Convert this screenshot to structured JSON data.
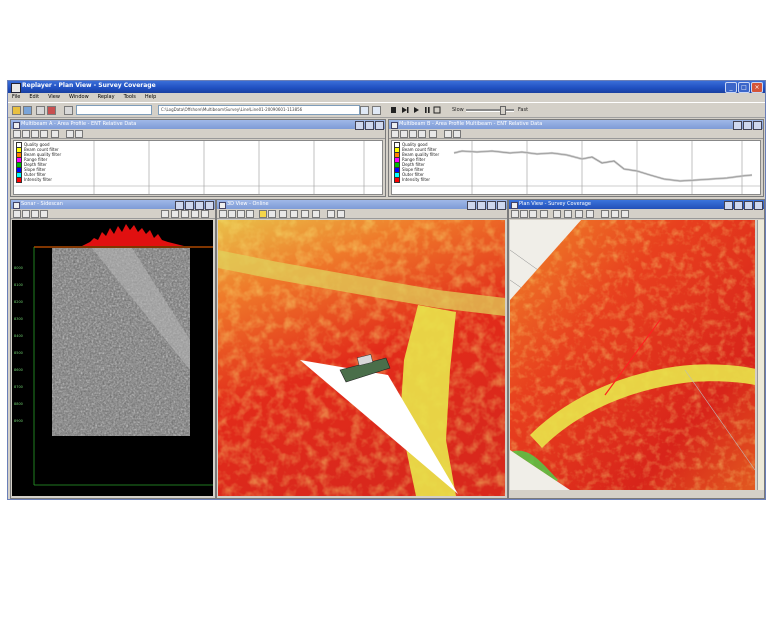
{
  "window": {
    "title": "Replayer - Plan View - Survey Coverage",
    "buttons": [
      "_",
      "□",
      "×"
    ]
  },
  "menu": [
    "File",
    "Edit",
    "View",
    "Window",
    "Replay",
    "Tools",
    "Help"
  ],
  "toolbar": {
    "path_value": "C:\\LogData\\Offshore\\Multibeam\\Survey\\Line\\Line01-20090601-113856",
    "speed_label": "Slow",
    "fast_label": "Fast"
  },
  "panes": {
    "profile_left": {
      "title": "Multibeam A - Area Profile - ENT Relative Data",
      "legend": [
        "Quality good",
        "Beam count filter",
        "Beam quality filter",
        "Range filter",
        "Depth filter",
        "Slope filter",
        "Outer filter",
        "Intensity filter"
      ],
      "legend_colors": [
        "#ffffff",
        "#ffff00",
        "#ff8000",
        "#ff00ff",
        "#00c000",
        "#0000ff",
        "#00ffff",
        "#ff0000"
      ]
    },
    "profile_right": {
      "title": "Multibeam B - Area Profile Multibeam - ENT Relative Data",
      "legend": [
        "Quality good",
        "Beam count filter",
        "Beam quality filter",
        "Range filter",
        "Depth filter",
        "Slope filter",
        "Outer filter",
        "Intensity filter"
      ],
      "legend_colors": [
        "#ffffff",
        "#ffff00",
        "#ff8000",
        "#ff00ff",
        "#00c000",
        "#0000ff",
        "#00ffff",
        "#ff0000"
      ]
    },
    "sonar": {
      "title": "Sonar - Sidescan",
      "axis_labels": [
        "8000",
        "8100",
        "8200",
        "8300",
        "8400",
        "8500",
        "8600",
        "8700",
        "8800",
        "8900"
      ]
    },
    "view3d": {
      "title": "3D View - Online"
    },
    "planview": {
      "title": "Plan View - Survey Coverage"
    }
  },
  "colors": {
    "title_active": "#2350b8",
    "title_inactive": "#7e9bd6",
    "panel_bg": "#d4d0c8",
    "accent_red": "#ff2020",
    "swath_yellow": "#e9e64a"
  }
}
